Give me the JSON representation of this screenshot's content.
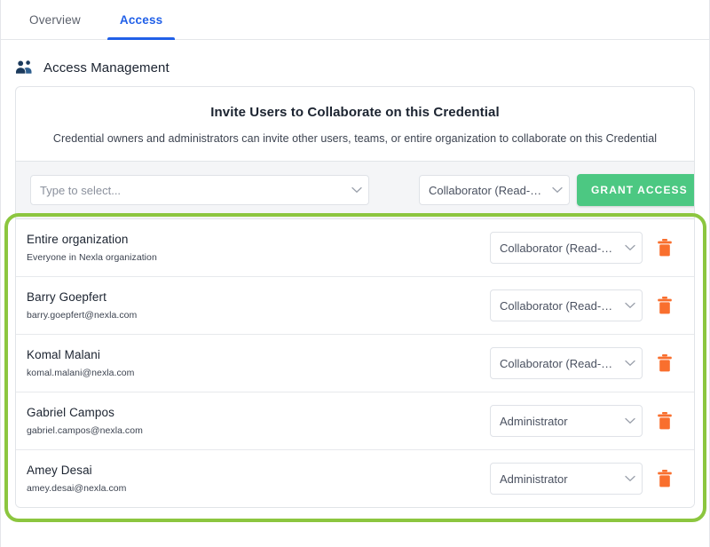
{
  "tabs": [
    {
      "label": "Overview",
      "active": false
    },
    {
      "label": "Access",
      "active": true
    }
  ],
  "section": {
    "icon": "people-group-icon",
    "title": "Access Management"
  },
  "card": {
    "title": "Invite Users to Collaborate on this Credential",
    "subtitle": "Credential owners and administrators can invite other users, teams, or entire organization to collaborate on this Credential"
  },
  "invite": {
    "user_placeholder": "Type to select...",
    "user_value": "",
    "role_value": "Collaborator (Read-…",
    "grant_label": "GRANT ACCESS"
  },
  "access_rows": [
    {
      "name": "Entire organization",
      "sub": "Everyone in Nexla organization",
      "role": "Collaborator (Read-…",
      "delete_icon": "trash-icon"
    },
    {
      "name": "Barry Goepfert",
      "sub": "barry.goepfert@nexla.com",
      "role": "Collaborator (Read-…",
      "delete_icon": "trash-icon"
    },
    {
      "name": "Komal Malani",
      "sub": "komal.malani@nexla.com",
      "role": "Collaborator (Read-…",
      "delete_icon": "trash-icon"
    },
    {
      "name": "Gabriel Campos",
      "sub": "gabriel.campos@nexla.com",
      "role": "Administrator",
      "delete_icon": "trash-icon"
    },
    {
      "name": "Amey Desai",
      "sub": "amey.desai@nexla.com",
      "role": "Administrator",
      "delete_icon": "trash-icon"
    }
  ],
  "colors": {
    "accent_blue": "#2160e8",
    "grant_green": "#4cc882",
    "highlight_green": "#8cc63f",
    "trash_orange": "#f96f2e",
    "text_dark": "#1b2330"
  }
}
